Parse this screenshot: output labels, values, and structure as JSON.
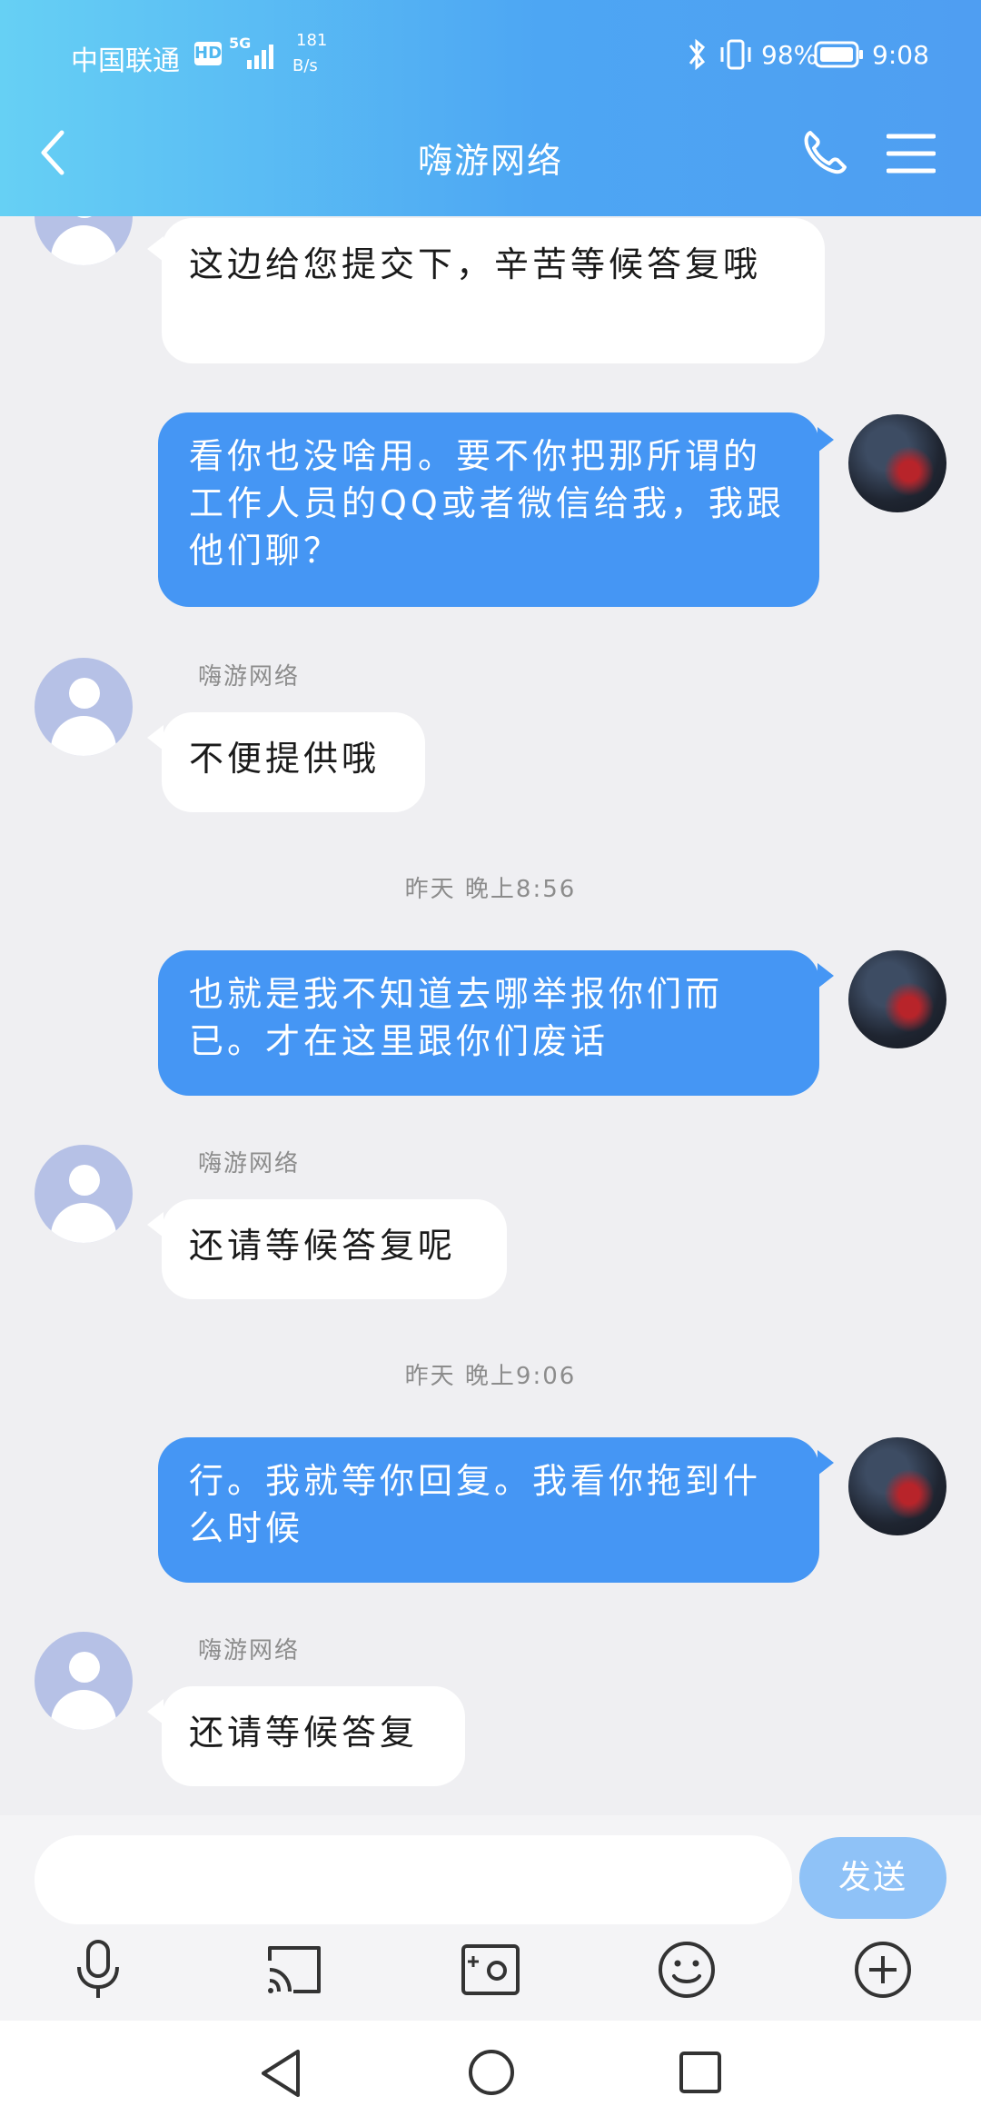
{
  "status": {
    "carrier": "中国联通",
    "hd": "HD",
    "net": "5G",
    "speed_value": "181",
    "speed_unit": "B/s",
    "battery": "98%",
    "time": "9:08"
  },
  "header": {
    "title": "嗨游网络"
  },
  "messages": [
    {
      "type": "in_partial",
      "text": "这边给您提交下，辛苦等候答复哦"
    },
    {
      "type": "out",
      "text": "看你也没啥用。要不你把那所谓的工作人员的QQ或者微信给我，我跟他们聊？"
    },
    {
      "type": "in",
      "sender": "嗨游网络",
      "text": "不便提供哦"
    },
    {
      "type": "time",
      "text": "昨天 晚上8:56"
    },
    {
      "type": "out",
      "text": "也就是我不知道去哪举报你们而已。才在这里跟你们废话"
    },
    {
      "type": "in",
      "sender": "嗨游网络",
      "text": "还请等候答复呢"
    },
    {
      "type": "time",
      "text": "昨天 晚上9:06"
    },
    {
      "type": "out",
      "text": "行。我就等你回复。我看你拖到什么时候"
    },
    {
      "type": "in",
      "sender": "嗨游网络",
      "text": "还请等候答复"
    }
  ],
  "composer": {
    "input_value": "",
    "send_label": "发送"
  },
  "icons": [
    "back-icon",
    "phone-icon",
    "menu-icon",
    "microphone-icon",
    "screen-cast-icon",
    "photo-icon",
    "emoji-icon",
    "plus-icon",
    "nav-back-icon",
    "nav-home-icon",
    "nav-recents-icon"
  ],
  "colors": {
    "header_start": "#66d0f4",
    "header_end": "#4f9ef2",
    "outgoing_bubble": "#4596f4",
    "incoming_bubble": "#ffffff",
    "send_button": "#8fc2f7",
    "background": "#efeff2"
  }
}
